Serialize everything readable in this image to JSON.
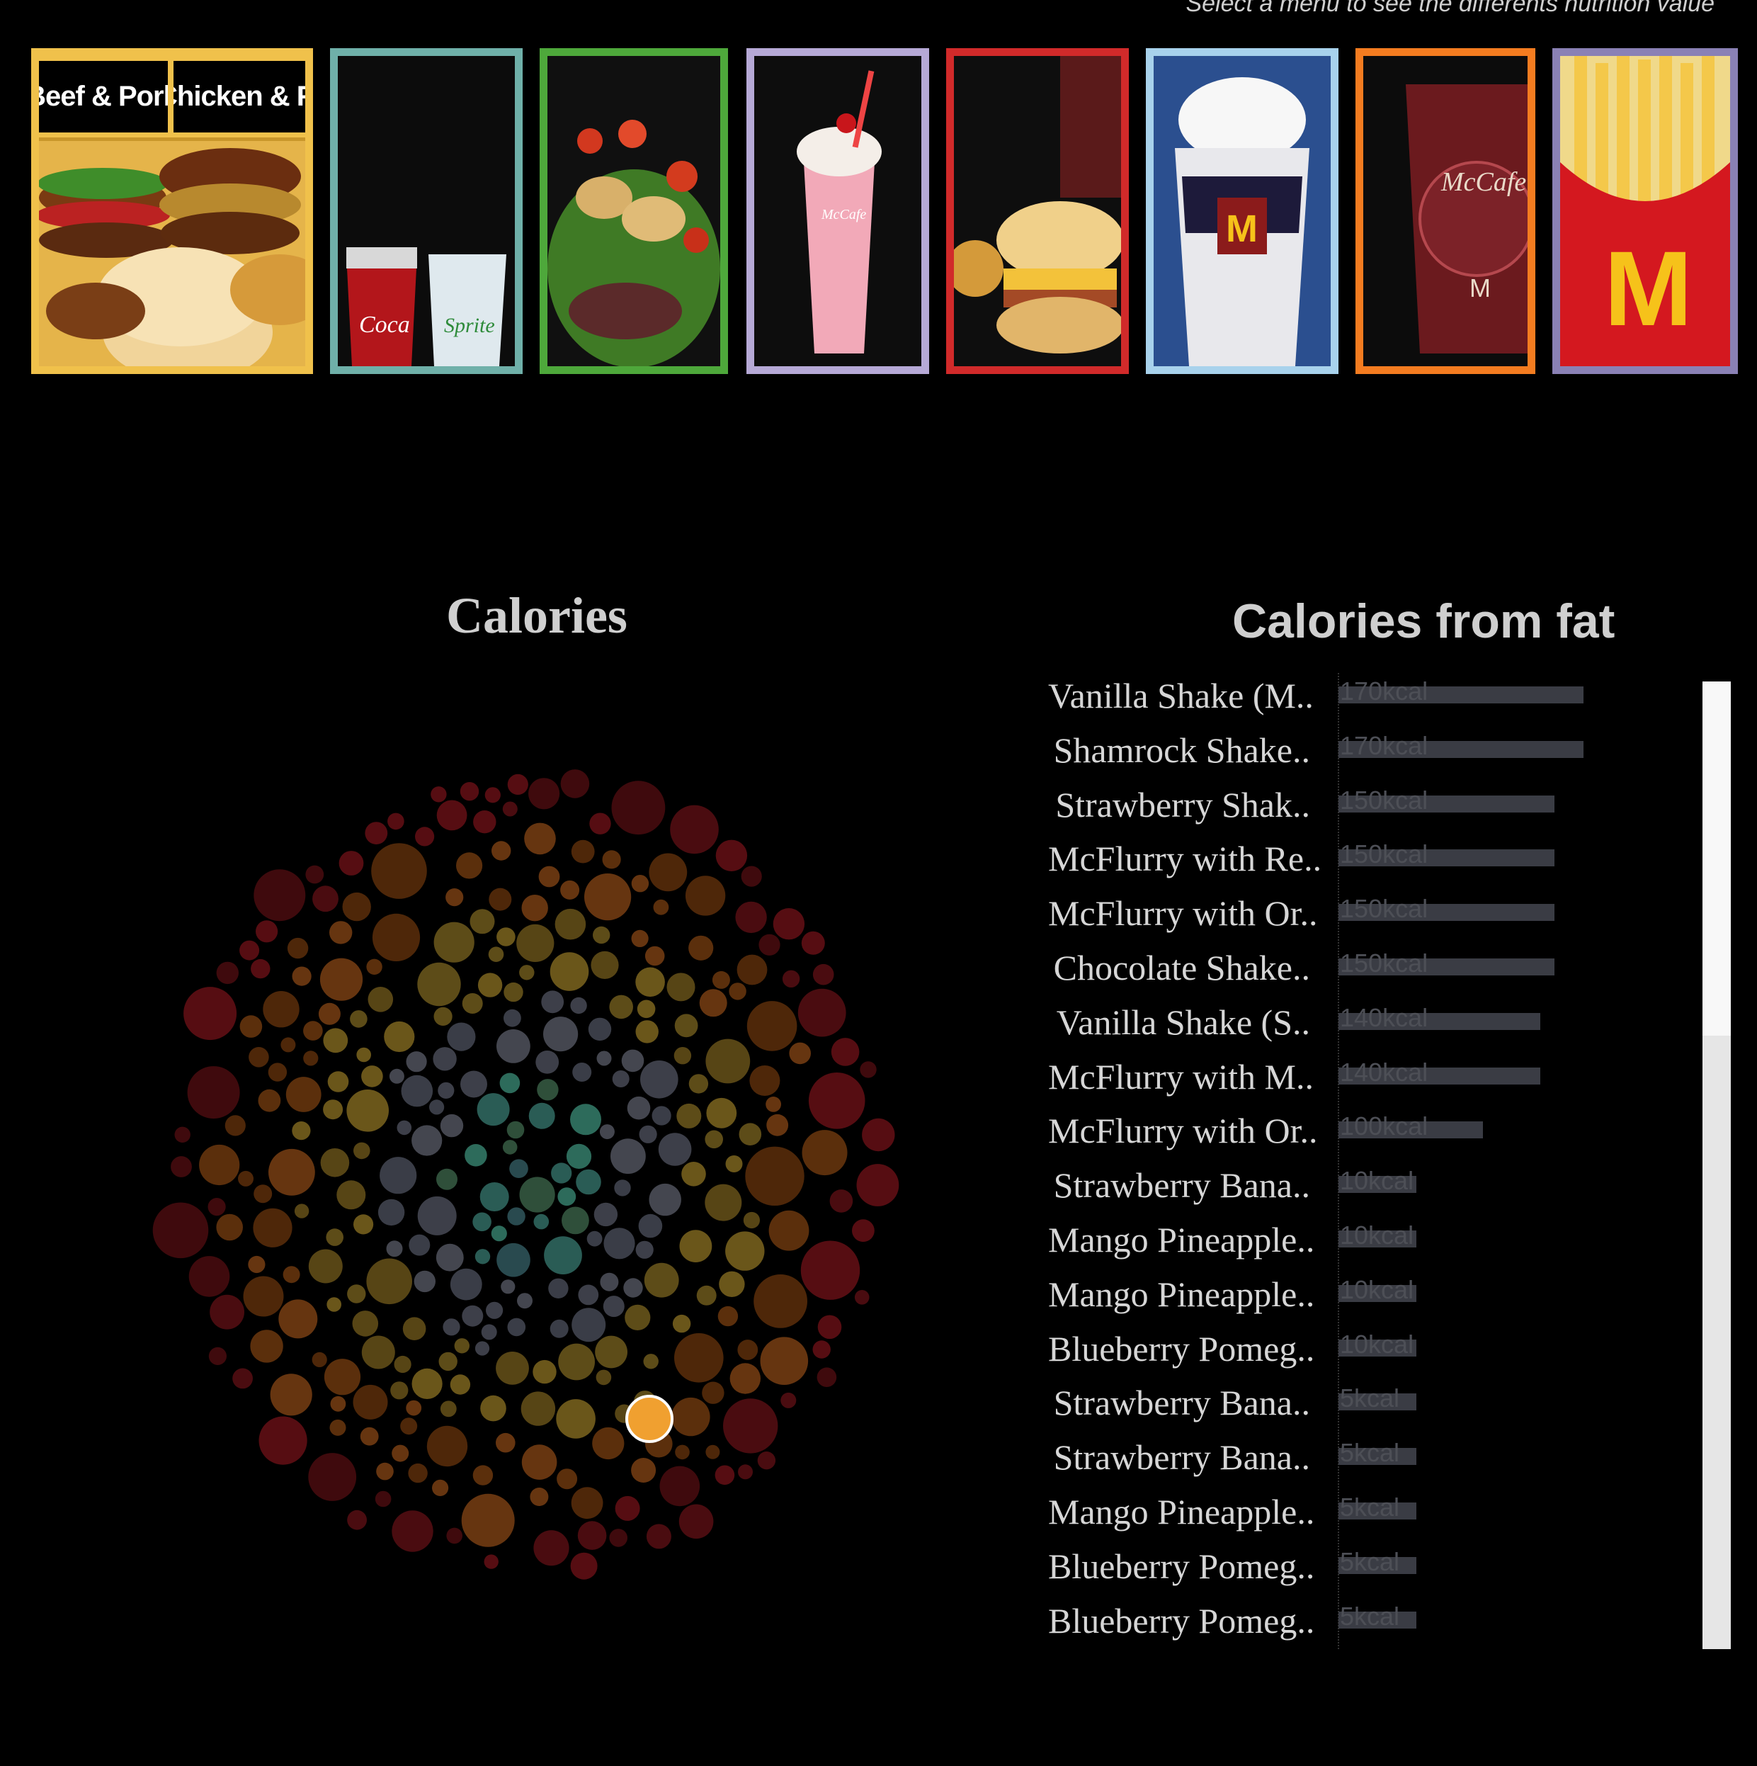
{
  "header": {
    "hint": "Select a menu to see the differents nutrition value"
  },
  "menu_categories": [
    {
      "id": "beef",
      "labels": [
        "Beef & Pork",
        "Chicken & F.."
      ],
      "image": "burgers",
      "border": "#f0c14b"
    },
    {
      "id": "beverages",
      "image": "coca-cola-and-sprite",
      "border": "#6fb0a9"
    },
    {
      "id": "salads",
      "image": "salad",
      "border": "#4ea83b"
    },
    {
      "id": "smoothies",
      "image": "strawberry-shake",
      "border": "#b6a9d6"
    },
    {
      "id": "breakfast",
      "image": "breakfast-biscuit",
      "border": "#d12a2a"
    },
    {
      "id": "desserts",
      "image": "mcflurry",
      "border": "#a8d2ec"
    },
    {
      "id": "coffee",
      "image": "mccafe-cup",
      "border": "#f47c20"
    },
    {
      "id": "snacks",
      "image": "fries",
      "border": "#8a81b5"
    }
  ],
  "calories_panel": {
    "title": "Calories",
    "highlight_color": "#f0a030"
  },
  "fat_panel": {
    "title": "Calories from fat",
    "items": [
      {
        "name": "Vanilla Shake (M..",
        "label": "170kcal",
        "value": 170
      },
      {
        "name": "Shamrock Shake..",
        "label": "170kcal",
        "value": 170
      },
      {
        "name": "Strawberry Shak..",
        "label": "150kcal",
        "value": 150
      },
      {
        "name": "McFlurry with Re..",
        "label": "150kcal",
        "value": 150
      },
      {
        "name": "McFlurry with Or..",
        "label": "150kcal",
        "value": 150
      },
      {
        "name": "Chocolate Shake..",
        "label": "150kcal",
        "value": 150
      },
      {
        "name": "Vanilla Shake (S..",
        "label": "140kcal",
        "value": 140
      },
      {
        "name": "McFlurry with M..",
        "label": "140kcal",
        "value": 140
      },
      {
        "name": "McFlurry with Or..",
        "label": "100kcal",
        "value": 100
      },
      {
        "name": "Strawberry Bana..",
        "label": "10kcal",
        "value": 10
      },
      {
        "name": "Mango Pineapple..",
        "label": "10kcal",
        "value": 10
      },
      {
        "name": "Mango Pineapple..",
        "label": "10kcal",
        "value": 10
      },
      {
        "name": "Blueberry Pomeg..",
        "label": "10kcal",
        "value": 10
      },
      {
        "name": "Strawberry Bana..",
        "label": "5kcal",
        "value": 5
      },
      {
        "name": "Strawberry Bana..",
        "label": "5kcal",
        "value": 5
      },
      {
        "name": "Mango Pineapple..",
        "label": "5kcal",
        "value": 5
      },
      {
        "name": "Blueberry Pomeg..",
        "label": "5kcal",
        "value": 5
      },
      {
        "name": "Blueberry Pomeg..",
        "label": "5kcal",
        "value": 5
      }
    ]
  },
  "colors": {
    "background": "#000000",
    "bar": "#3a3c44",
    "bar_text": "#4d4f56"
  }
}
